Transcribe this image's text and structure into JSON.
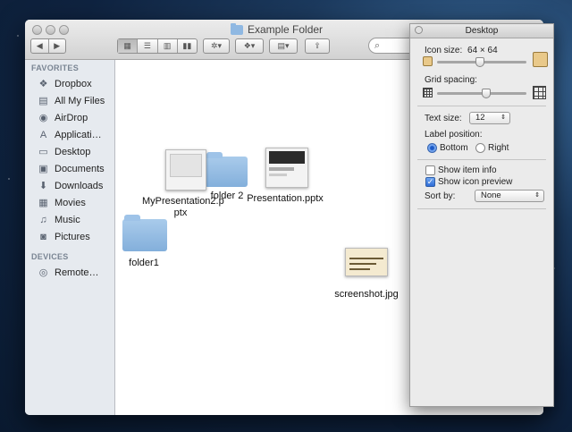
{
  "window": {
    "title": "Example Folder",
    "search_placeholder": ""
  },
  "toolbar": {
    "view_buttons": [
      "icon-view",
      "list-view",
      "column-view",
      "coverflow-view"
    ],
    "action_icon": "gear-icon",
    "dropbox_icon": "dropbox-icon",
    "arrange_icon": "arrange-icon",
    "share_icon": "share-icon"
  },
  "sidebar": {
    "favorites_heading": "FAVORITES",
    "favorites": [
      {
        "label": "Dropbox",
        "icon": "dropbox-icon"
      },
      {
        "label": "All My Files",
        "icon": "files-icon"
      },
      {
        "label": "AirDrop",
        "icon": "airdrop-icon"
      },
      {
        "label": "Applicati…",
        "icon": "applications-icon"
      },
      {
        "label": "Desktop",
        "icon": "desktop-icon"
      },
      {
        "label": "Documents",
        "icon": "documents-icon"
      },
      {
        "label": "Downloads",
        "icon": "downloads-icon"
      },
      {
        "label": "Movies",
        "icon": "movies-icon"
      },
      {
        "label": "Music",
        "icon": "music-icon"
      },
      {
        "label": "Pictures",
        "icon": "pictures-icon"
      }
    ],
    "devices_heading": "DEVICES",
    "devices": [
      {
        "label": "Remote…",
        "icon": "disc-icon"
      }
    ]
  },
  "files": [
    {
      "name": "MyPresentation2.p\nptx",
      "kind": "presentation"
    },
    {
      "name": "folder 2",
      "kind": "folder"
    },
    {
      "name": "Presentation.pptx",
      "kind": "presentation"
    },
    {
      "name": "folder1",
      "kind": "folder"
    },
    {
      "name": "screenshot.jpg",
      "kind": "image"
    }
  ],
  "panel": {
    "title": "Desktop",
    "icon_size_label": "Icon size:",
    "icon_size_value": "64 × 64",
    "icon_size_level": 0.48,
    "grid_spacing_label": "Grid spacing:",
    "grid_spacing_level": 0.55,
    "text_size_label": "Text size:",
    "text_size_value": "12",
    "label_position_label": "Label position:",
    "label_bottom": "Bottom",
    "label_right": "Right",
    "label_position_selected": "Bottom",
    "show_item_info": "Show item info",
    "show_item_info_checked": false,
    "show_icon_preview": "Show icon preview",
    "show_icon_preview_checked": true,
    "sort_by_label": "Sort by:",
    "sort_by_value": "None"
  }
}
